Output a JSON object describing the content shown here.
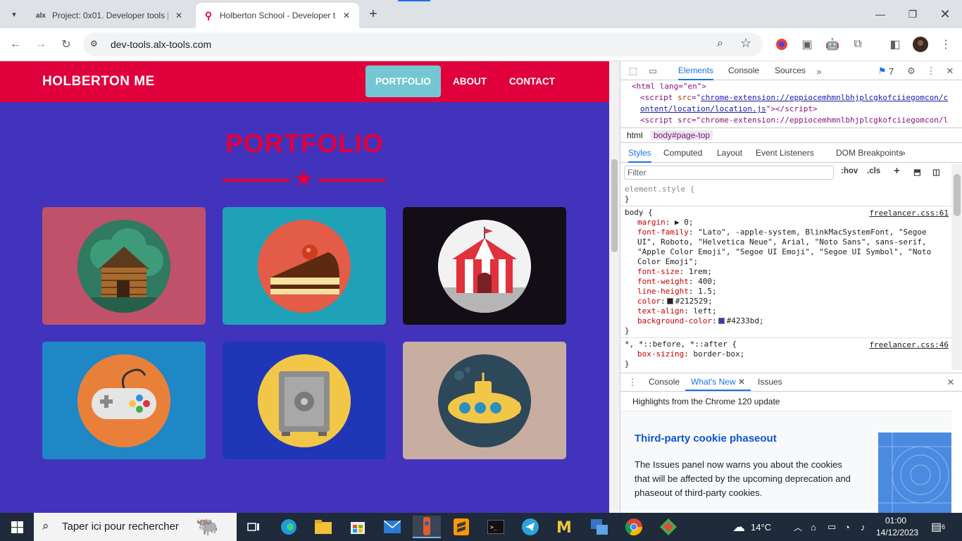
{
  "browser": {
    "tabs": [
      {
        "title": "Project: 0x01. Developer tools |",
        "favicon": "alx"
      },
      {
        "title": "Holberton School - Developer t",
        "favicon": "holberton-logo"
      }
    ],
    "url": "dev-tools.alx-tools.com"
  },
  "page": {
    "brand": "HOLBERTON ME",
    "nav": [
      "PORTFOLIO",
      "ABOUT",
      "CONTACT"
    ],
    "title": "PORTFOLIO",
    "colors": {
      "primary": "#e0003c",
      "background": "#4233bd",
      "active_nav": "#74c7d2"
    },
    "cards": [
      {
        "name": "cabin",
        "bg": "#c0516b",
        "disc": "#2b6b58"
      },
      {
        "name": "cake",
        "bg": "#1fa2b8",
        "disc": "#e35c48"
      },
      {
        "name": "circus",
        "bg": "#130e15",
        "disc": "#f2f2f2"
      },
      {
        "name": "game-controller",
        "bg": "#1f87c6",
        "disc": "#e9803a"
      },
      {
        "name": "safe",
        "bg": "#1f37b6",
        "disc": "#f2c747"
      },
      {
        "name": "submarine",
        "bg": "#c8aea1",
        "disc": "#2d4859"
      }
    ]
  },
  "devtools": {
    "tabs": [
      "Elements",
      "Console",
      "Sources"
    ],
    "issue_count": "7",
    "dom": {
      "line1": "<html lang=\"en\">",
      "line2_src_a": "chrome-extension://eppiocemhmnlbhjplcgkofciiegomcon/c",
      "line2_src_b": "ontent/location/location.js",
      "line3": "<script src=\"chrome-extension://eppiocemhmnlbhjplcgkofciiegomcon/l"
    },
    "breadcrumbs": [
      "html",
      "body#page-top"
    ],
    "subtabs": [
      "Styles",
      "Computed",
      "Layout",
      "Event Listeners",
      "DOM Breakpoints"
    ],
    "filter_placeholder": "Filter",
    "hov": ":hov",
    "cls": ".cls",
    "element_style": "element.style {",
    "close_brace": "}",
    "body_rule": {
      "selector": "body {",
      "source": "freelancer.css:61",
      "declarations": [
        {
          "prop": "margin",
          "value": "▶ 0;"
        },
        {
          "prop": "font-family",
          "value": "\"Lato\", -apple-system, BlinkMacSystemFont, \"Segoe UI\", Roboto, \"Helvetica Neue\", Arial, \"Noto Sans\", sans-serif, \"Apple Color Emoji\", \"Segoe UI Emoji\", \"Segoe UI Symbol\", \"Noto Color Emoji\";"
        },
        {
          "prop": "font-size",
          "value": "1rem;"
        },
        {
          "prop": "font-weight",
          "value": "400;"
        },
        {
          "prop": "line-height",
          "value": "1.5;"
        },
        {
          "prop": "color",
          "value": "#212529;",
          "swatch": "#212529"
        },
        {
          "prop": "text-align",
          "value": "left;"
        },
        {
          "prop": "background-color",
          "value": "#4233bd;",
          "swatch": "#4233bd"
        }
      ]
    },
    "universal_rule": {
      "selector": "*, *::before, *::after {",
      "source": "freelancer.css:46",
      "declarations": [
        {
          "prop": "box-sizing",
          "value": "border-box;"
        }
      ]
    },
    "drawer": {
      "tabs": [
        "Console",
        "What's New",
        "Issues"
      ],
      "header": "Highlights from the Chrome 120 update",
      "feature_title": "Third-party cookie phaseout",
      "feature_text": "The Issues panel now warns you about the cookies that will be affected by the upcoming deprecation and phaseout of third-party cookies."
    }
  },
  "taskbar": {
    "search_placeholder": "Taper ici pour rechercher",
    "weather": "14°C",
    "time": "01:00",
    "date": "14/12/2023",
    "notifications": "6"
  }
}
